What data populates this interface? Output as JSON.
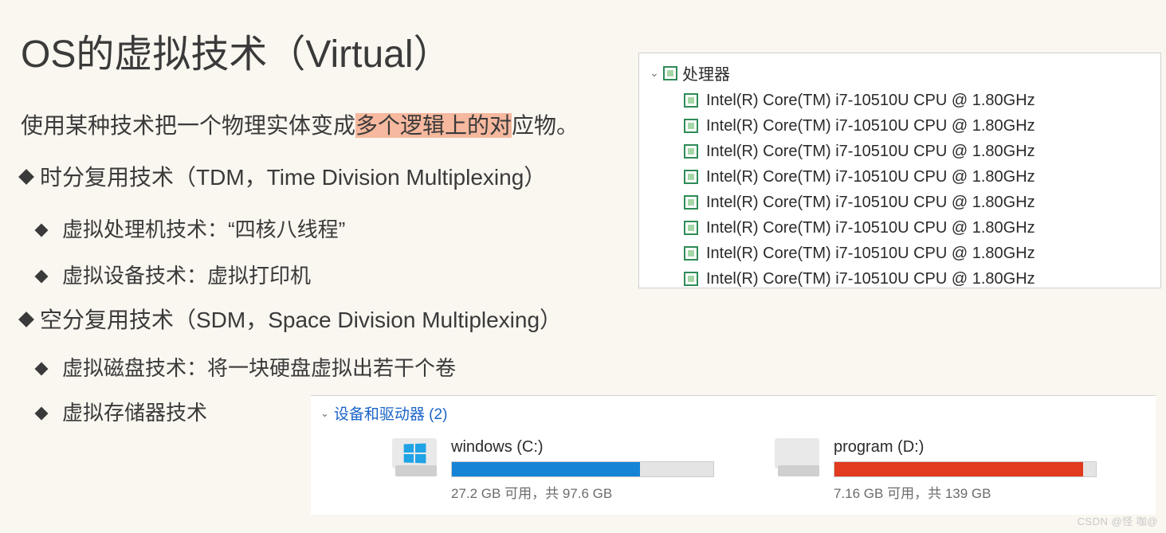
{
  "title": "OS的虚拟技术（Virtual）",
  "desc": {
    "pre": "使用某种技术把一个物理实体变成",
    "highlight": "多个逻辑上的对",
    "post": "应物。"
  },
  "section1": "时分复用技术（TDM，Time Division Multiplexing）",
  "sub1a": "虚拟处理机技术：“四核八线程”",
  "sub1b": "虚拟设备技术：虚拟打印机",
  "section2": "空分复用技术（SDM，Space Division Multiplexing）",
  "sub2a": "虚拟磁盘技术：将一块硬盘虚拟出若干个卷",
  "sub2b": "虚拟存储器技术",
  "proc": {
    "root": "处理器",
    "items": [
      "Intel(R) Core(TM) i7-10510U CPU @ 1.80GHz",
      "Intel(R) Core(TM) i7-10510U CPU @ 1.80GHz",
      "Intel(R) Core(TM) i7-10510U CPU @ 1.80GHz",
      "Intel(R) Core(TM) i7-10510U CPU @ 1.80GHz",
      "Intel(R) Core(TM) i7-10510U CPU @ 1.80GHz",
      "Intel(R) Core(TM) i7-10510U CPU @ 1.80GHz",
      "Intel(R) Core(TM) i7-10510U CPU @ 1.80GHz",
      "Intel(R) Core(TM) i7-10510U CPU @ 1.80GHz"
    ]
  },
  "drives": {
    "header": "设备和驱动器 (2)",
    "c": {
      "name": "windows (C:)",
      "stats": "27.2 GB 可用，共 97.6 GB",
      "fill_pct": 72,
      "color": "blue"
    },
    "d": {
      "name": "program (D:)",
      "stats": "7.16 GB 可用，共 139 GB",
      "fill_pct": 95,
      "color": "red"
    }
  },
  "watermark": "CSDN @怪 咖@"
}
